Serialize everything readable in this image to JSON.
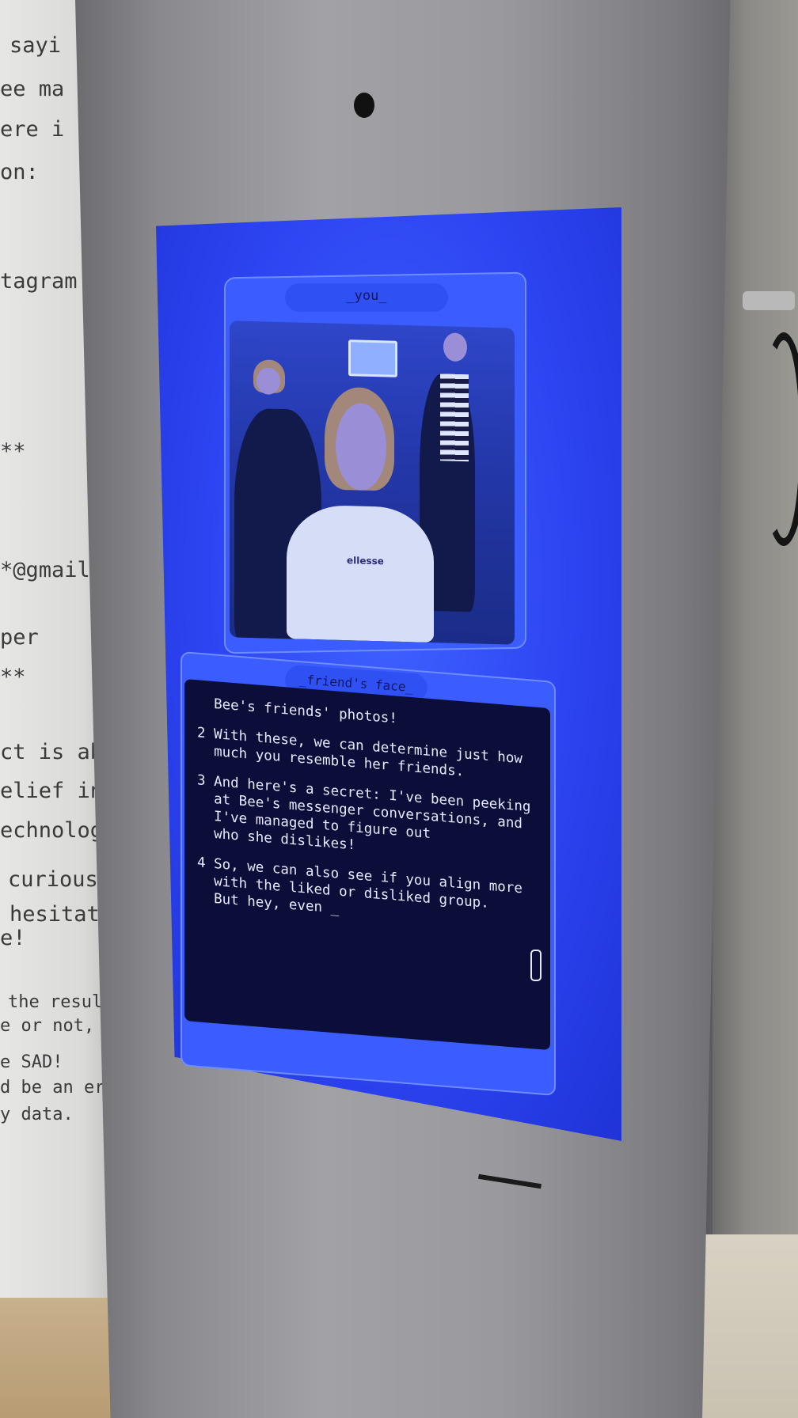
{
  "poster": {
    "lines": [
      "sayi",
      "ee ma",
      "ere i",
      "on:",
      "tagram",
      "**",
      "*@gmail.",
      "per",
      "**",
      "ct is abo",
      "elief in",
      "echnology",
      "curious a",
      "hesitate",
      "e!",
      "the result",
      "e or not,",
      "e SAD!",
      "d be an err",
      "y data."
    ]
  },
  "screen": {
    "you_label": "_you_",
    "friend_label": "_friend's face_",
    "terminal_paragraphs": [
      "  Bee's friends' photos!",
      "2 With these, we can determine just how\n  much you resemble her friends.",
      "3 And here's a secret: I've been peeking\n  at Bee's messenger conversations, and\n  I've managed to figure out\n  who she dislikes!",
      "4 So, we can also see if you align more\n  with the liked or disliked group.\n  But hey, even _"
    ]
  },
  "photo": {
    "shirt_logo": "ellesse"
  }
}
